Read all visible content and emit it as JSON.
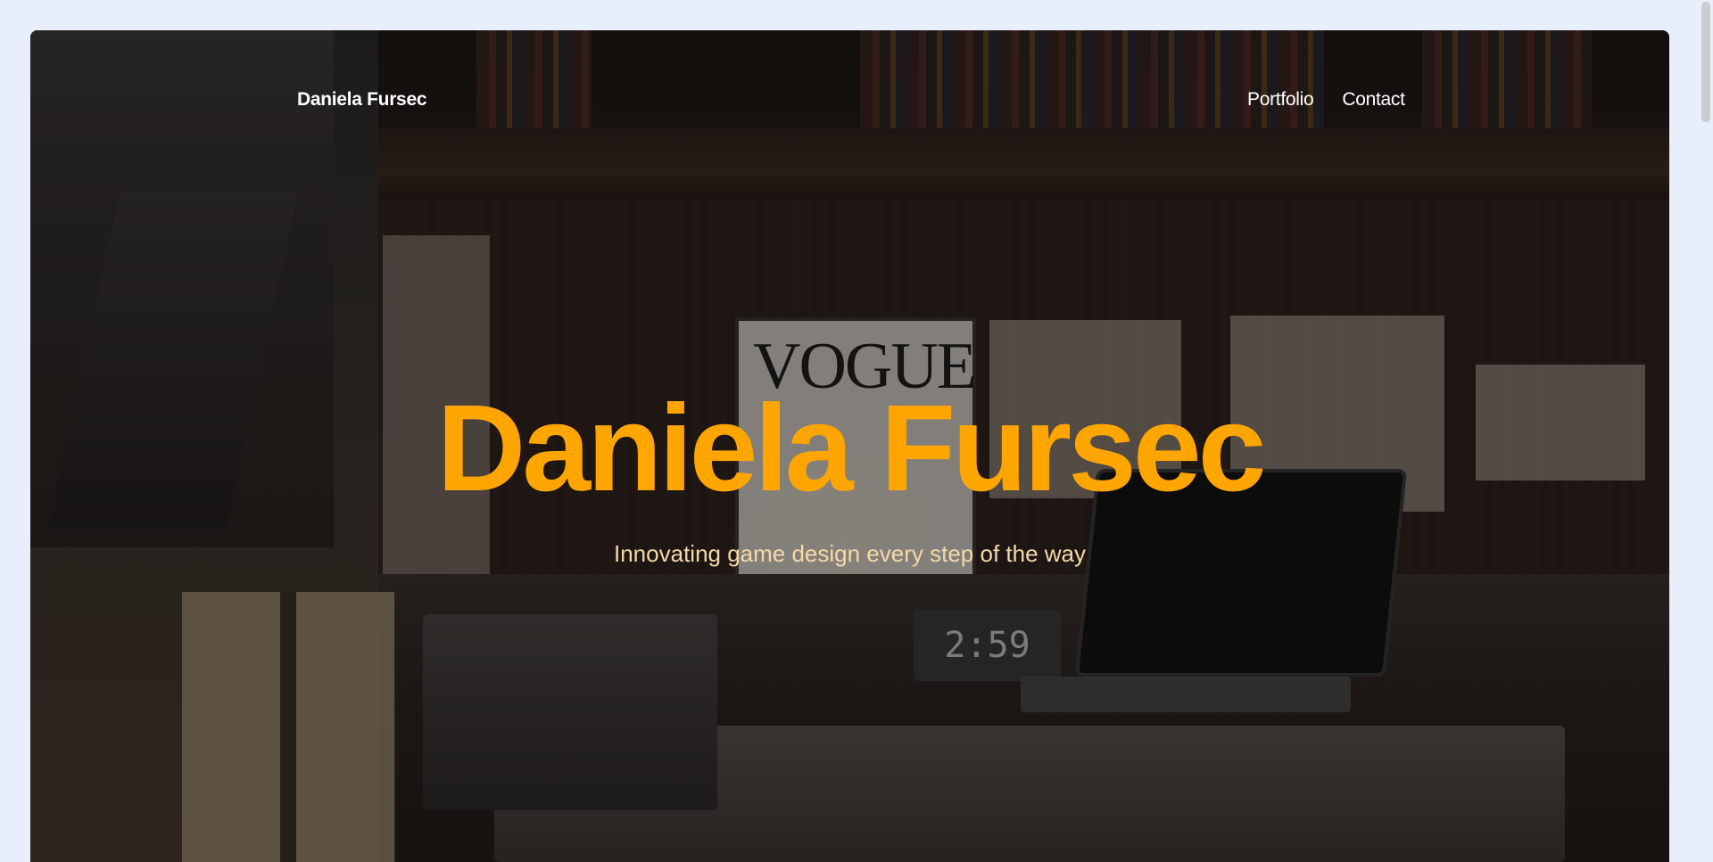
{
  "header": {
    "brand": "Daniela Fursec",
    "nav": [
      {
        "label": "Portfolio"
      },
      {
        "label": "Contact"
      }
    ]
  },
  "hero": {
    "title": "Daniela Fursec",
    "subtitle": "Innovating game design every step of the way",
    "background": {
      "poster_text": "VOGUE",
      "clock_text": "2:59"
    }
  },
  "colors": {
    "accent": "#ffa500",
    "subtitle": "#f4d9a9",
    "page_background": "#e8eefb"
  },
  "icons": []
}
